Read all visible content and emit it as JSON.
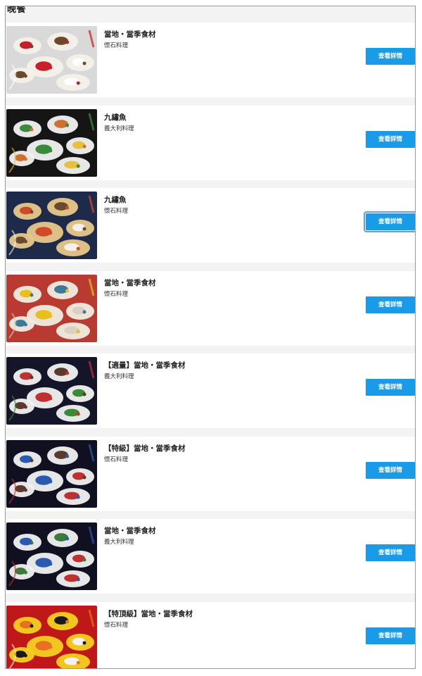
{
  "section_title": "晚餐",
  "items": [
    {
      "title": "當地・當季食材",
      "subtitle": "懷石料理",
      "button_label": "查看詳情",
      "image_icon": "food-photo",
      "palette": {
        "bg": "#d9d9d9",
        "plate": "#f4f1ea",
        "accent": "#c8202a",
        "accent2": "#6b4a2b",
        "accent3": "#ffffff"
      }
    },
    {
      "title": "九繡魚",
      "subtitle": "義大利料理",
      "button_label": "查看詳情",
      "image_icon": "food-photo",
      "palette": {
        "bg": "#151515",
        "plate": "#f2f2f2",
        "accent": "#3a8a3a",
        "accent2": "#d07030",
        "accent3": "#e8c040"
      }
    },
    {
      "title": "九繡魚",
      "subtitle": "懷石料理",
      "button_label": "查看詳情",
      "image_icon": "food-photo",
      "focused": true,
      "palette": {
        "bg": "#1e2a4a",
        "plate": "#e8c88a",
        "accent": "#d04a2a",
        "accent2": "#6b4a2b",
        "accent3": "#f4f1ea"
      }
    },
    {
      "title": "當地・當季食材",
      "subtitle": "懷石料理",
      "button_label": "查看詳情",
      "image_icon": "food-photo",
      "palette": {
        "bg": "#b83a30",
        "plate": "#f0ece0",
        "accent": "#e8c020",
        "accent2": "#3a7a9a",
        "accent3": "#d8d0c0"
      }
    },
    {
      "title": "【適量】當地・當季食材",
      "subtitle": "義大利料理",
      "button_label": "查看詳情",
      "image_icon": "food-photo",
      "palette": {
        "bg": "#15152a",
        "plate": "#f2f2f2",
        "accent": "#c03030",
        "accent2": "#5a3a2a",
        "accent3": "#3a8a3a"
      }
    },
    {
      "title": "【特級】當地・當季食材",
      "subtitle": "懷石料理",
      "button_label": "查看詳情",
      "image_icon": "food-photo",
      "palette": {
        "bg": "#101020",
        "plate": "#f2f2f2",
        "accent": "#2a5ab0",
        "accent2": "#5a3a2a",
        "accent3": "#c03030"
      }
    },
    {
      "title": "當地・當季食材",
      "subtitle": "義大利料理",
      "button_label": "查看詳情",
      "image_icon": "food-photo",
      "palette": {
        "bg": "#101020",
        "plate": "#f2f2f2",
        "accent": "#2a5ab0",
        "accent2": "#3a7a3a",
        "accent3": "#c03030"
      }
    },
    {
      "title": "【特頂級】當地・當季食材",
      "subtitle": "懷石料理",
      "button_label": "查看詳情",
      "image_icon": "food-photo",
      "palette": {
        "bg": "#c01818",
        "plate": "#f4d020",
        "accent": "#e87020",
        "accent2": "#1a1a1a",
        "accent3": "#f2f2f2"
      }
    }
  ]
}
